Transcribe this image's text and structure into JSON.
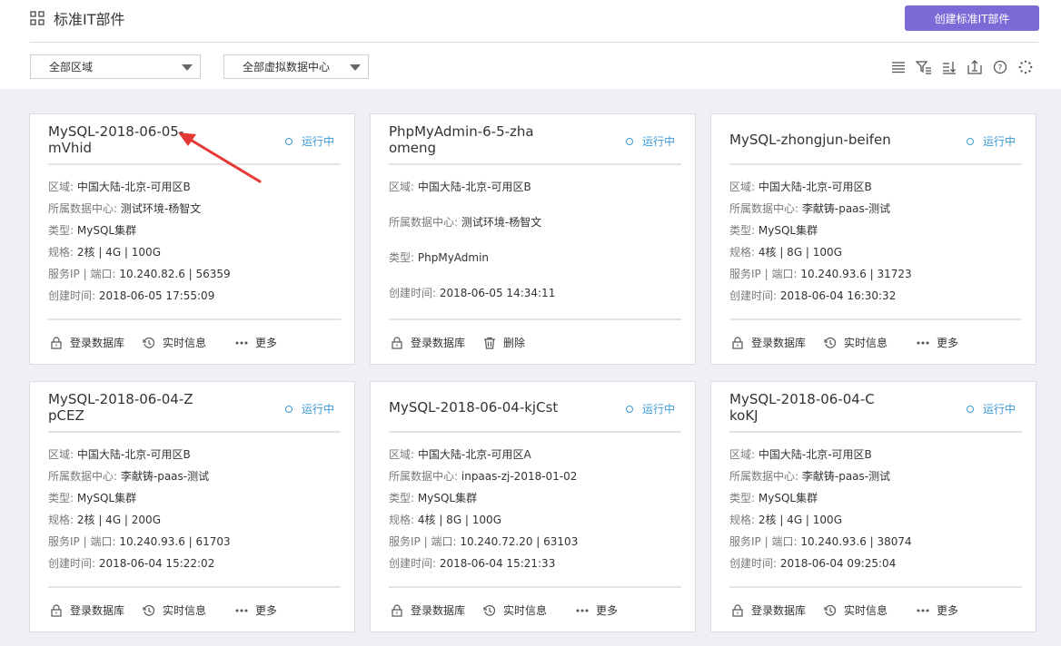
{
  "header": {
    "title": "标准IT部件",
    "create_button": "创建标准IT部件"
  },
  "filters": {
    "region": "全部区域",
    "datacenter": "全部虚拟数据中心"
  },
  "toolbar_icons": [
    "list-icon",
    "filter-icon",
    "sort-icon",
    "export-icon",
    "help-icon",
    "refresh-icon"
  ],
  "labels": {
    "region": "区域:",
    "datacenter": "所属数据中心:",
    "type": "类型:",
    "spec": "规格:",
    "ip_port": "服务IP | 端口:",
    "created": "创建时间:"
  },
  "cards": [
    {
      "name": "MySQL-2018-06-05-mVhid",
      "status": "运行中",
      "region": "中国大陆-北京-可用区B",
      "datacenter": "测试环境-杨智文",
      "type": "MySQL集群",
      "spec": "2核 | 4G | 100G",
      "ip_port": "10.240.82.6 | 56359",
      "created": "2018-06-05 17:55:09",
      "actions": [
        "登录数据库",
        "实时信息",
        "更多"
      ]
    },
    {
      "name": "PhpMyAdmin-6-5-zhaomeng",
      "status": "运行中",
      "region": "中国大陆-北京-可用区B",
      "datacenter": "测试环境-杨智文",
      "type": "PhpMyAdmin",
      "created": "2018-06-05 14:34:11",
      "actions": [
        "登录数据库",
        "删除"
      ]
    },
    {
      "name": "MySQL-zhongjun-beifen",
      "status": "运行中",
      "region": "中国大陆-北京-可用区B",
      "datacenter": "李献铸-paas-测试",
      "type": "MySQL集群",
      "spec": "4核 | 8G | 100G",
      "ip_port": "10.240.93.6 | 31723",
      "created": "2018-06-04 16:30:32",
      "actions": [
        "登录数据库",
        "实时信息",
        "更多"
      ]
    },
    {
      "name": "MySQL-2018-06-04-ZpCEZ",
      "status": "运行中",
      "region": "中国大陆-北京-可用区B",
      "datacenter": "李献铸-paas-测试",
      "type": "MySQL集群",
      "spec": "2核 | 4G | 200G",
      "ip_port": "10.240.93.6 | 61703",
      "created": "2018-06-04 15:22:02",
      "actions": [
        "登录数据库",
        "实时信息",
        "更多"
      ]
    },
    {
      "name": "MySQL-2018-06-04-kjCst",
      "status": "运行中",
      "region": "中国大陆-北京-可用区A",
      "datacenter": "inpaas-zj-2018-01-02",
      "type": "MySQL集群",
      "spec": "4核 | 8G | 100G",
      "ip_port": "10.240.72.20 | 63103",
      "created": "2018-06-04 15:21:33",
      "actions": [
        "登录数据库",
        "实时信息",
        "更多"
      ]
    },
    {
      "name": "MySQL-2018-06-04-CkoKJ",
      "status": "运行中",
      "region": "中国大陆-北京-可用区B",
      "datacenter": "李献铸-paas-测试",
      "type": "MySQL集群",
      "spec": "2核 | 4G | 100G",
      "ip_port": "10.240.93.6 | 38074",
      "created": "2018-06-04 09:25:04",
      "actions": [
        "登录数据库",
        "实时信息",
        "更多"
      ]
    }
  ],
  "colors": {
    "accent": "#7b6bd6",
    "status": "#3c9ad6",
    "annotation_arrow": "#e53935"
  }
}
